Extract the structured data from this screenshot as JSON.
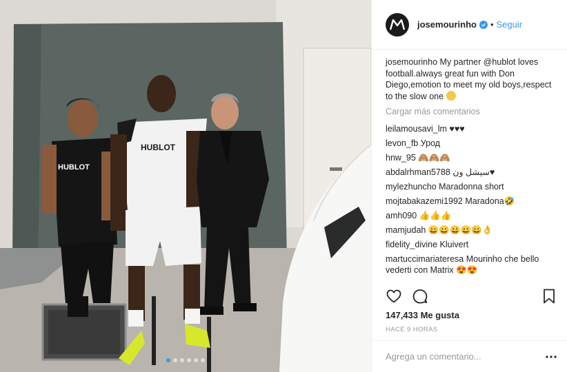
{
  "post": {
    "author": "josemourinho",
    "follow_label": "Seguir",
    "separator": "•",
    "caption_user": "josemourinho",
    "caption_text": "My partner @hublot loves football.always great fun with Don Diego,emotion to meet my old boys,respect to the slow one",
    "load_more_label": "Cargar más comentarios",
    "likes_text": "147,433 Me gusta",
    "time_text": "HACE 9 HORAS",
    "add_comment_placeholder": "Agrega un comentario...",
    "carousel": {
      "count": 6,
      "active_index": 0
    },
    "shirt_brand": "HUBLOT"
  },
  "comments": [
    {
      "user": "leilamousavi_lm",
      "text": "♥♥♥"
    },
    {
      "user": "levon_fb",
      "text": "Урод"
    },
    {
      "user": "hnw_95",
      "text": "🙈🙈🙈"
    },
    {
      "user": "abdalrhman5788",
      "text": "سيشل ون♥"
    },
    {
      "user": "mylezhuncho",
      "text": "Maradonna short"
    },
    {
      "user": "mojtabakazemi1992",
      "text": "Maradona🤣"
    },
    {
      "user": "amh090",
      "text": "👍👍👍"
    },
    {
      "user": "mamjudah",
      "text": "😀😀😀😀😀👌"
    },
    {
      "user": "fidelity_divine",
      "text": "Kluivert"
    },
    {
      "user": "martuccimariateresa",
      "text": "Mourinho che bello vederti con Matrix 😍😍"
    }
  ],
  "colors": {
    "accent": "#3897f0",
    "text": "#262626",
    "muted": "#999999"
  },
  "icons": {
    "like": "heart-icon",
    "comment": "comment-icon",
    "save": "bookmark-icon",
    "more": "more-icon",
    "verified": "verified-badge-icon"
  }
}
